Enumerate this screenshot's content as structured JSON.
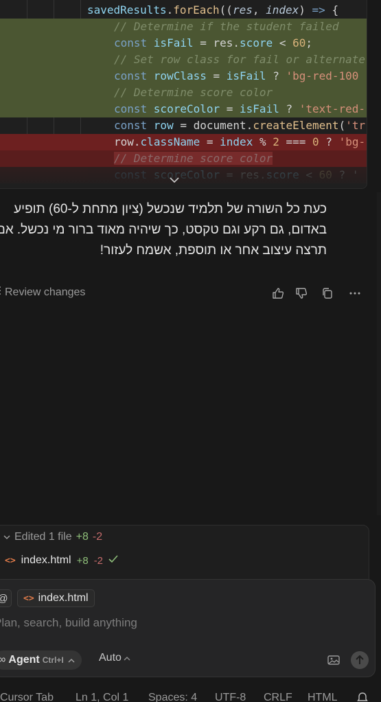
{
  "code_lines": [
    {
      "kind": "context",
      "indent": 126,
      "tokens": [
        {
          "c": "t-var",
          "t": "savedResults"
        },
        {
          "c": "t-p",
          "t": "."
        },
        {
          "c": "t-fn",
          "t": "forEach"
        },
        {
          "c": "t-p",
          "t": "(("
        },
        {
          "c": "t-it",
          "t": "res"
        },
        {
          "c": "t-p",
          "t": ", "
        },
        {
          "c": "t-it",
          "t": "index"
        },
        {
          "c": "t-p",
          "t": ") "
        },
        {
          "c": "t-kw",
          "t": "=>"
        },
        {
          "c": "t-p",
          "t": " {"
        }
      ]
    },
    {
      "kind": "added",
      "indent": 165,
      "tokens": [
        {
          "c": "t-cm",
          "t": "// Determine if the student failed"
        }
      ]
    },
    {
      "kind": "added",
      "indent": 165,
      "tokens": [
        {
          "c": "t-kw",
          "t": "const "
        },
        {
          "c": "t-var",
          "t": "isFail"
        },
        {
          "c": "t-p",
          "t": " = "
        },
        {
          "c": "t-p",
          "t": "res"
        },
        {
          "c": "t-p",
          "t": "."
        },
        {
          "c": "t-var",
          "t": "score"
        },
        {
          "c": "t-p",
          "t": " < "
        },
        {
          "c": "t-num",
          "t": "60"
        },
        {
          "c": "t-p",
          "t": ";"
        }
      ]
    },
    {
      "kind": "added",
      "indent": 165,
      "tokens": [
        {
          "c": "t-cm",
          "t": "// Set row class for fail or alternate"
        }
      ]
    },
    {
      "kind": "added",
      "indent": 165,
      "tokens": [
        {
          "c": "t-kw",
          "t": "const "
        },
        {
          "c": "t-var",
          "t": "rowClass"
        },
        {
          "c": "t-p",
          "t": " = "
        },
        {
          "c": "t-var",
          "t": "isFail"
        },
        {
          "c": "t-p",
          "t": " ? "
        },
        {
          "c": "t-str",
          "t": "'bg-red-100"
        }
      ]
    },
    {
      "kind": "added",
      "indent": 165,
      "tokens": [
        {
          "c": "t-cm",
          "t": "// Determine score color"
        }
      ]
    },
    {
      "kind": "added",
      "indent": 165,
      "tokens": [
        {
          "c": "t-kw",
          "t": "const "
        },
        {
          "c": "t-var",
          "t": "scoreColor"
        },
        {
          "c": "t-p",
          "t": " = "
        },
        {
          "c": "t-var",
          "t": "isFail"
        },
        {
          "c": "t-p",
          "t": " ? "
        },
        {
          "c": "t-str",
          "t": "'text-red-"
        }
      ]
    },
    {
      "kind": "context",
      "indent": 165,
      "tokens": [
        {
          "c": "t-kw",
          "t": "const "
        },
        {
          "c": "t-var",
          "t": "row"
        },
        {
          "c": "t-p",
          "t": " = "
        },
        {
          "c": "t-p",
          "t": "document"
        },
        {
          "c": "t-p",
          "t": "."
        },
        {
          "c": "t-fn",
          "t": "createElement"
        },
        {
          "c": "t-p",
          "t": "("
        },
        {
          "c": "t-str",
          "t": "'tr"
        }
      ]
    },
    {
      "kind": "removed-strong",
      "indent": 165,
      "tokens": [
        {
          "c": "t-p",
          "t": "row"
        },
        {
          "c": "t-p",
          "t": "."
        },
        {
          "c": "t-var",
          "t": "className"
        },
        {
          "c": "t-p",
          "t": " = "
        },
        {
          "c": "t-var",
          "t": "index"
        },
        {
          "c": "t-p",
          "t": " % "
        },
        {
          "c": "t-num",
          "t": "2"
        },
        {
          "c": "t-p",
          "t": " === "
        },
        {
          "c": "t-num",
          "t": "0"
        },
        {
          "c": "t-p",
          "t": " ? "
        },
        {
          "c": "t-str",
          "t": "'bg-"
        }
      ]
    },
    {
      "kind": "removed",
      "indent": 165,
      "tokens": [
        {
          "c": "t-cm-r word-hl",
          "t": "// Determine score color"
        }
      ]
    },
    {
      "kind": "removed-fade",
      "indent": 165,
      "tokens": [
        {
          "c": "t-kw",
          "t": "const "
        },
        {
          "c": "t-var",
          "t": "scoreColor"
        },
        {
          "c": "t-p",
          "t": " = "
        },
        {
          "c": "t-p",
          "t": "res"
        },
        {
          "c": "t-p",
          "t": "."
        },
        {
          "c": "t-var",
          "t": "score"
        },
        {
          "c": "t-p",
          "t": " < "
        },
        {
          "c": "t-num",
          "t": "60"
        },
        {
          "c": "t-p",
          "t": " ? '"
        }
      ]
    }
  ],
  "message": {
    "lines": [
      "כעת כל השורה של תלמיד שנכשל (ציון מתחת ל-60) תופיע",
      "באדום, גם רקע וגם טקסט, כך שיהיה מאוד ברור מי נכשל. אם",
      "תרצה עיצוב אחר או תוספת, אשמח לעזור!"
    ]
  },
  "actions": {
    "review_label": "Review changes"
  },
  "edited": {
    "title": "Edited 1 file",
    "added": "+8",
    "removed": "-2",
    "file_name": "index.html",
    "file_added": "+8",
    "file_removed": "-2"
  },
  "composer": {
    "at_symbol": "@",
    "context_file": "index.html",
    "placeholder": "Plan, search, build anything",
    "agent_label": "Agent",
    "agent_shortcut": "Ctrl+I",
    "model_label": "Auto"
  },
  "statusbar": {
    "cursor_tab": "Cursor Tab",
    "position": "Ln 1, Col 1",
    "spaces": "Spaces: 4",
    "encoding": "UTF-8",
    "eol": "CRLF",
    "language": "HTML"
  },
  "colors": {
    "added_bg": "#4b5632",
    "removed_bg": "#5a1d1d",
    "plus": "#8fbf7a",
    "minus": "#c46b6b"
  }
}
